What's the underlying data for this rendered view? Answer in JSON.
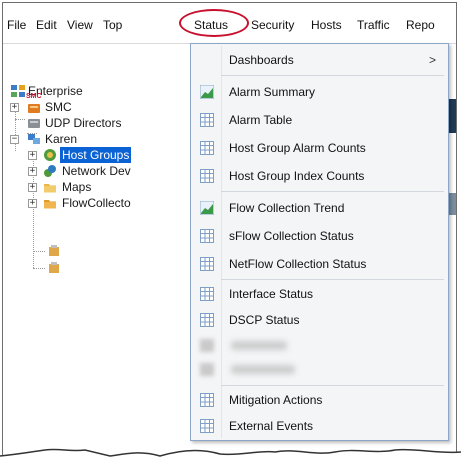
{
  "menubar": {
    "items": [
      "File",
      "Edit",
      "View",
      "Top",
      "Status",
      "Security",
      "Hosts",
      "Traffic",
      "Repo"
    ]
  },
  "tree": {
    "enterprise": "Enterprise",
    "smc": "SMC",
    "smc_badge": "SMC",
    "udp_directors": "UDP Directors",
    "karen": "Karen",
    "host_groups": "Host Groups",
    "network_devices": "Network Dev",
    "maps": "Maps",
    "flow_collectors": "FlowCollecto"
  },
  "status_menu": {
    "dashboards": "Dashboards",
    "dashboards_chevron": ">",
    "alarm_summary": "Alarm Summary",
    "alarm_table": "Alarm Table",
    "host_group_alarm_counts": "Host Group Alarm Counts",
    "host_group_index_counts": "Host Group Index Counts",
    "flow_collection_trend": "Flow Collection Trend",
    "sflow_collection_status": "sFlow Collection Status",
    "netflow_collection_status": "NetFlow Collection Status",
    "interface_status": "Interface Status",
    "dscp_status": "DSCP Status",
    "mitigation_actions": "Mitigation Actions",
    "external_events": "External Events"
  },
  "colors": {
    "highlight_ring": "#c8102e",
    "selection": "#0a62d4",
    "menu_background": "#f4f5f7"
  }
}
